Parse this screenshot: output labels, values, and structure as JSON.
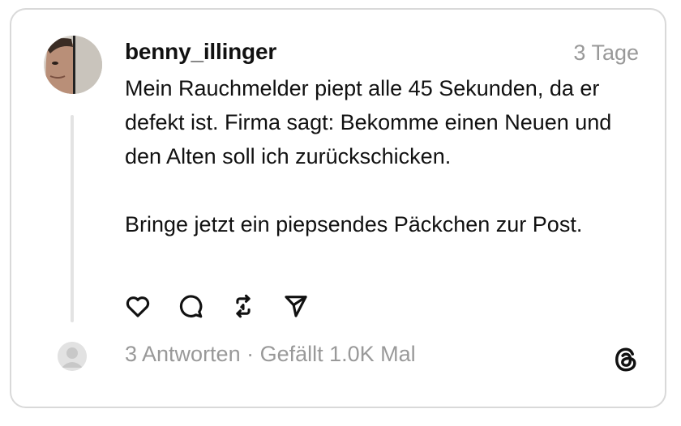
{
  "post": {
    "username": "benny_illinger",
    "time": "3 Tage",
    "paragraphs": [
      "Mein Rauchmelder piept alle 45 Sekunden, da er defekt ist. Firma sagt: Bekomme einen Neuen und den Alten soll ich zurückschicken.",
      "Bringe jetzt ein piepsendes Päckchen zur Post."
    ]
  },
  "actions": {
    "like": "heart-icon",
    "comment": "comment-icon",
    "repost": "repost-icon",
    "share": "send-icon"
  },
  "stats": {
    "replies": "3 Antworten",
    "separator": " · ",
    "likes": "Gefällt 1.0K Mal"
  },
  "colors": {
    "text": "#111111",
    "muted": "#999999",
    "border": "#d9d9d9",
    "thread_line": "#e3e3e3"
  }
}
